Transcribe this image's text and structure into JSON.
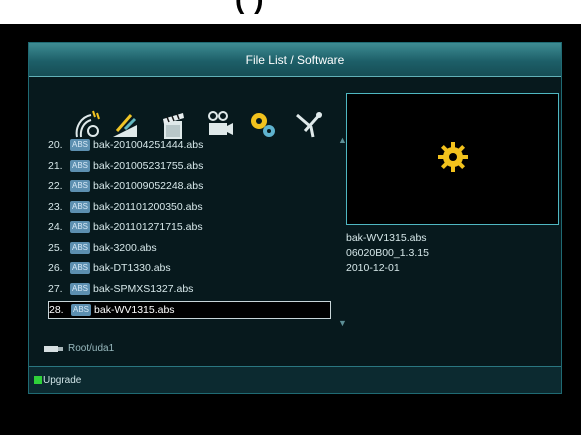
{
  "top_fragment": "(      )",
  "header": {
    "title": "File List / Software"
  },
  "toolbar": {
    "icons": [
      "satellite-dish-icon",
      "antenna-tools-icon",
      "clapperboard-icon",
      "camera-icon",
      "gears-icon",
      "tools-icon"
    ]
  },
  "files": [
    {
      "num": "20.",
      "badge": "ABS",
      "name": "bak-201004251444.abs"
    },
    {
      "num": "21.",
      "badge": "ABS",
      "name": "bak-201005231755.abs"
    },
    {
      "num": "22.",
      "badge": "ABS",
      "name": "bak-201009052248.abs"
    },
    {
      "num": "23.",
      "badge": "ABS",
      "name": "bak-201101200350.abs"
    },
    {
      "num": "24.",
      "badge": "ABS",
      "name": "bak-201101271715.abs"
    },
    {
      "num": "25.",
      "badge": "ABS",
      "name": "bak-3200.abs"
    },
    {
      "num": "26.",
      "badge": "ABS",
      "name": "bak-DT1330.abs"
    },
    {
      "num": "27.",
      "badge": "ABS",
      "name": "bak-SPMXS1327.abs"
    },
    {
      "num": "28.",
      "badge": "ABS",
      "name": "bak-WV1315.abs"
    }
  ],
  "selected_index": 8,
  "preview_info": {
    "filename": "bak-WV1315.abs",
    "version": "06020B00_1.3.15",
    "date": "2010-12-01"
  },
  "path": "Root/uda1",
  "footer": {
    "action_label": "Upgrade",
    "action_color": "#2fd13a"
  },
  "colors": {
    "accent": "#4fb7c2",
    "title_bar": "#2a747c",
    "gear": "#f2c21d"
  }
}
